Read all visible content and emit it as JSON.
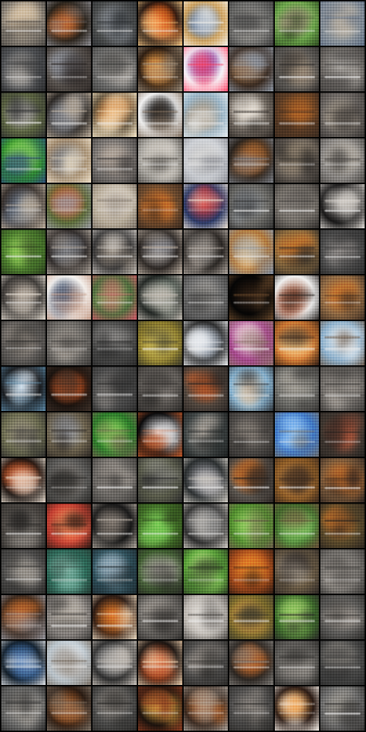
{
  "grid": {
    "rows": 16,
    "cols": 8,
    "tiles": [
      {
        "base": "#8a8277",
        "accent": "#d8c4a8",
        "detail": "#4a4744"
      },
      {
        "base": "#2a231b",
        "accent": "#c26b35",
        "detail": "#8d8d93"
      },
      {
        "base": "#4a4c4c",
        "accent": "#8a8f96",
        "detail": "#2b2e31"
      },
      {
        "base": "#1a0f0d",
        "accent": "#e4661f",
        "detail": "#ffd08a"
      },
      {
        "base": "#d1a35c",
        "accent": "#5e7aa1",
        "detail": "#f3f1eb"
      },
      {
        "base": "#6a6a68",
        "accent": "#9d9a96",
        "detail": "#3c3c3c"
      },
      {
        "base": "#6da74c",
        "accent": "#9a8b77",
        "detail": "#2d4a20"
      },
      {
        "base": "#8c949b",
        "accent": "#d2c2ab",
        "detail": "#5d6d83"
      },
      {
        "base": "#4d4f52",
        "accent": "#b8b3ad",
        "detail": "#2a2b2d"
      },
      {
        "base": "#5b5550",
        "accent": "#8a8d95",
        "detail": "#2b2523"
      },
      {
        "base": "#6a6a69",
        "accent": "#b6b1ab",
        "detail": "#3b3b3a"
      },
      {
        "base": "#2e1e12",
        "accent": "#f0a04a",
        "detail": "#9c8d7a"
      },
      {
        "base": "#f7f7fb",
        "accent": "#8d4aa6",
        "detail": "#ff4a6c"
      },
      {
        "base": "#3a2b21",
        "accent": "#a06c3b",
        "detail": "#8b95a3"
      },
      {
        "base": "#5f5c58",
        "accent": "#a08f7b",
        "detail": "#2f2d2c"
      },
      {
        "base": "#6b6763",
        "accent": "#aaa6a1",
        "detail": "#3d3b3a"
      },
      {
        "base": "#5b6441",
        "accent": "#a4a19c",
        "detail": "#2d2e2f"
      },
      {
        "base": "#2b2724",
        "accent": "#8b8d93",
        "detail": "#c2b3a0"
      },
      {
        "base": "#6a5b45",
        "accent": "#d57a29",
        "detail": "#fff0d1"
      },
      {
        "base": "#f2f2f2",
        "accent": "#0f0f10",
        "detail": "#7d6b5a"
      },
      {
        "base": "#9db7c8",
        "accent": "#a48f76",
        "detail": "#e8eef1"
      },
      {
        "base": "#6d655d",
        "accent": "#f0e9df",
        "detail": "#2f2a26"
      },
      {
        "base": "#5a3c25",
        "accent": "#c16c28",
        "detail": "#3a2a20"
      },
      {
        "base": "#6a6561",
        "accent": "#b3a897",
        "detail": "#3a3634"
      },
      {
        "base": "#2d8a2b",
        "accent": "#80d34e",
        "detail": "#2f4d7a"
      },
      {
        "base": "#a58f74",
        "accent": "#7b7f86",
        "detail": "#efe1c9"
      },
      {
        "base": "#777370",
        "accent": "#b6aa9f",
        "detail": "#3f3c3b"
      },
      {
        "base": "#a8a59f",
        "accent": "#efe9e0",
        "detail": "#4e4b47"
      },
      {
        "base": "#cfd2d7",
        "accent": "#f3f2ef",
        "detail": "#8b8d94"
      },
      {
        "base": "#2b241e",
        "accent": "#b06a32",
        "detail": "#7a7d84"
      },
      {
        "base": "#5d5650",
        "accent": "#9a8b77",
        "detail": "#2d2a27"
      },
      {
        "base": "#8c8986",
        "accent": "#b9b3aa",
        "detail": "#4b4845"
      },
      {
        "base": "#3a332f",
        "accent": "#5f6f86",
        "detail": "#c0b3a2"
      },
      {
        "base": "#5b6b3a",
        "accent": "#d05a2a",
        "detail": "#9a9aa2"
      },
      {
        "base": "#b8ad9b",
        "accent": "#dfd6ca",
        "detail": "#7b7167"
      },
      {
        "base": "#6d4b2f",
        "accent": "#e07a2b",
        "detail": "#3a2a1f"
      },
      {
        "base": "#2c3a66",
        "accent": "#d43b3b",
        "detail": "#f1e5d6"
      },
      {
        "base": "#6b6a66",
        "accent": "#9aa0a7",
        "detail": "#2f2f2f"
      },
      {
        "base": "#6f6a64",
        "accent": "#a19b94",
        "detail": "#2f2c2a"
      },
      {
        "base": "#171616",
        "accent": "#8f8c88",
        "detail": "#e7e2dc"
      },
      {
        "base": "#4a7a2d",
        "accent": "#95d15a",
        "detail": "#2a3c1d"
      },
      {
        "base": "#2c2725",
        "accent": "#7b7e85",
        "detail": "#b7aea4"
      },
      {
        "base": "#3b3a3a",
        "accent": "#8a7f73",
        "detail": "#d6d1cb"
      },
      {
        "base": "#2a2522",
        "accent": "#8e8f95",
        "detail": "#c5b8aa"
      },
      {
        "base": "#2a2623",
        "accent": "#7e7a76",
        "detail": "#b1a8a0"
      },
      {
        "base": "#b27a3c",
        "accent": "#f0d0a0",
        "detail": "#7c8ea5"
      },
      {
        "base": "#8b6a3e",
        "accent": "#d0772a",
        "detail": "#2b2a28"
      },
      {
        "base": "#4a4a4a",
        "accent": "#9a9592",
        "detail": "#2b2b2b"
      },
      {
        "base": "#3d3a37",
        "accent": "#a0958a",
        "detail": "#e7dfd4"
      },
      {
        "base": "#f6f3f0",
        "accent": "#4a5f7d",
        "detail": "#c49a85"
      },
      {
        "base": "#4c6d3d",
        "accent": "#9aa46b",
        "detail": "#d35a6a"
      },
      {
        "base": "#1e2320",
        "accent": "#7f8a80",
        "detail": "#c8c1b8"
      },
      {
        "base": "#6b6b6b",
        "accent": "#a8a5a0",
        "detail": "#3a3a3a"
      },
      {
        "base": "#050505",
        "accent": "#2a1c12",
        "detail": "#6b4a2c"
      },
      {
        "base": "#f0f0ef",
        "accent": "#a0563a",
        "detail": "#2a2523"
      },
      {
        "base": "#8f6a45",
        "accent": "#d27a2e",
        "detail": "#3b2c22"
      },
      {
        "base": "#5e5b58",
        "accent": "#9c938a",
        "detail": "#2f2e2c"
      },
      {
        "base": "#6d6a66",
        "accent": "#aaa39b",
        "detail": "#3b3937"
      },
      {
        "base": "#4a4a49",
        "accent": "#8c8a88",
        "detail": "#2a2a2a"
      },
      {
        "base": "#8a7a2c",
        "accent": "#d7c35c",
        "detail": "#3b3a2c"
      },
      {
        "base": "#2a2a2a",
        "accent": "#a6b0bd",
        "detail": "#f0f2f5"
      },
      {
        "base": "#a5488c",
        "accent": "#f2d7df",
        "detail": "#8a6e68"
      },
      {
        "base": "#d27b34",
        "accent": "#ffd089",
        "detail": "#2b1b14"
      },
      {
        "base": "#8fb1cc",
        "accent": "#f0f6fb",
        "detail": "#6b5a4b"
      },
      {
        "base": "#1a1c1f",
        "accent": "#d8e6f2",
        "detail": "#5b88a6"
      },
      {
        "base": "#1b130f",
        "accent": "#d3561f",
        "detail": "#3c2f27"
      },
      {
        "base": "#4b4b4b",
        "accent": "#8e8a86",
        "detail": "#2b2b2b"
      },
      {
        "base": "#5a5652",
        "accent": "#97908a",
        "detail": "#2c2a28"
      },
      {
        "base": "#51473f",
        "accent": "#c65d2b",
        "detail": "#2b2624"
      },
      {
        "base": "#8ab4d0",
        "accent": "#d9c7b1",
        "detail": "#2b2f34"
      },
      {
        "base": "#6b6b67",
        "accent": "#a39f97",
        "detail": "#353331"
      },
      {
        "base": "#6e6a66",
        "accent": "#aaa49d",
        "detail": "#3b3937"
      },
      {
        "base": "#6a6a4f",
        "accent": "#a8a08b",
        "detail": "#2b2b2b"
      },
      {
        "base": "#6e644f",
        "accent": "#a4a7ad",
        "detail": "#2b2622"
      },
      {
        "base": "#2c7a2a",
        "accent": "#85d05a",
        "detail": "#6a5b4a"
      },
      {
        "base": "#0a0a0b",
        "accent": "#f6f6f8",
        "detail": "#c45a2a"
      },
      {
        "base": "#3e4444",
        "accent": "#b6aea5",
        "detail": "#1c1f1f"
      },
      {
        "base": "#4d4a47",
        "accent": "#8f877f",
        "detail": "#2a2827"
      },
      {
        "base": "#3f79c6",
        "accent": "#9fd1ff",
        "detail": "#6b6c6d"
      },
      {
        "base": "#433a33",
        "accent": "#b2573b",
        "detail": "#262321"
      },
      {
        "base": "#1b1411",
        "accent": "#cf5b2b",
        "detail": "#eaded0"
      },
      {
        "base": "#5b5a58",
        "accent": "#9b948d",
        "detail": "#2b2a28"
      },
      {
        "base": "#6a6763",
        "accent": "#a39c95",
        "detail": "#3b3937"
      },
      {
        "base": "#595b4a",
        "accent": "#8c8c84",
        "detail": "#2b2b2b"
      },
      {
        "base": "#2b2f30",
        "accent": "#9a9aa0",
        "detail": "#d5d0c8"
      },
      {
        "base": "#5b5650",
        "accent": "#c36d2b",
        "detail": "#2b2522"
      },
      {
        "base": "#8c5b26",
        "accent": "#f0a450",
        "detail": "#3a2a1f"
      },
      {
        "base": "#7b5a3b",
        "accent": "#e07a2b",
        "detail": "#2b2320"
      },
      {
        "base": "#4a4642",
        "accent": "#8f8a84",
        "detail": "#2a2826"
      },
      {
        "base": "#c44033",
        "accent": "#ff8a5a",
        "detail": "#2a1a14"
      },
      {
        "base": "#171717",
        "accent": "#6a625b",
        "detail": "#b2a99f"
      },
      {
        "base": "#3f6b26",
        "accent": "#7fd15a",
        "detail": "#2a3b1a"
      },
      {
        "base": "#2a2a2a",
        "accent": "#8a8a8a",
        "detail": "#d8d3cc"
      },
      {
        "base": "#4f8a2d",
        "accent": "#a2e06b",
        "detail": "#6b5a4a"
      },
      {
        "base": "#3d6a2a",
        "accent": "#8bd36a",
        "detail": "#6b4f3a"
      },
      {
        "base": "#5b4a2b",
        "accent": "#d77a2b",
        "detail": "#2b2520"
      },
      {
        "base": "#4b4a49",
        "accent": "#9b968f",
        "detail": "#2b2a28"
      },
      {
        "base": "#2e6b5a",
        "accent": "#8fc6b6",
        "detail": "#243a33"
      },
      {
        "base": "#2e4f5a",
        "accent": "#9bb2c0",
        "detail": "#1f2b30"
      },
      {
        "base": "#3b5a2c",
        "accent": "#a8a39c",
        "detail": "#2b2a28"
      },
      {
        "base": "#5aa33a",
        "accent": "#b0e07a",
        "detail": "#2b3a22"
      },
      {
        "base": "#a24a1c",
        "accent": "#f08a2b",
        "detail": "#2b1a12"
      },
      {
        "base": "#6a5b45",
        "accent": "#b9ad9c",
        "detail": "#2b2624"
      },
      {
        "base": "#6f6c68",
        "accent": "#a59f98",
        "detail": "#3b3937"
      },
      {
        "base": "#3a2a20",
        "accent": "#c56a2b",
        "detail": "#9a9aa2"
      },
      {
        "base": "#8c8783",
        "accent": "#b9b2a9",
        "detail": "#3b3937"
      },
      {
        "base": "#2b1b14",
        "accent": "#e07a2b",
        "detail": "#f2e0c6"
      },
      {
        "base": "#6b6864",
        "accent": "#a29c95",
        "detail": "#2f2d2b"
      },
      {
        "base": "#bcb7b1",
        "accent": "#f0ece7",
        "detail": "#4b4845"
      },
      {
        "base": "#7a6a2c",
        "accent": "#e0a44a",
        "detail": "#3b3a2c"
      },
      {
        "base": "#3b6a2a",
        "accent": "#9fd16a",
        "detail": "#2b2a28"
      },
      {
        "base": "#5b5a58",
        "accent": "#9b948d",
        "detail": "#2b2a28"
      },
      {
        "base": "#0f1a24",
        "accent": "#4a78b2",
        "detail": "#e6e9ee"
      },
      {
        "base": "#bfcbd4",
        "accent": "#f0f2f5",
        "detail": "#7a6f63"
      },
      {
        "base": "#2a2a2a",
        "accent": "#8a8a8a",
        "detail": "#cfc8c0"
      },
      {
        "base": "#1b1411",
        "accent": "#d65b2a",
        "detail": "#f0d2b0"
      },
      {
        "base": "#4b4a49",
        "accent": "#8d8781",
        "detail": "#2b2a28"
      },
      {
        "base": "#2b2622",
        "accent": "#c56a2b",
        "detail": "#7d7a76"
      },
      {
        "base": "#5b5956",
        "accent": "#9a958f",
        "detail": "#2b2a28"
      },
      {
        "base": "#4a4a49",
        "accent": "#8b8781",
        "detail": "#2a2a2a"
      },
      {
        "base": "#6a6a69",
        "accent": "#a8a39c",
        "detail": "#2b2b2b"
      },
      {
        "base": "#2a1b12",
        "accent": "#c46a2b",
        "detail": "#7a6f63"
      },
      {
        "base": "#4a4a49",
        "accent": "#8d8781",
        "detail": "#2b2a28"
      },
      {
        "base": "#1b120d",
        "accent": "#f0b44a",
        "detail": "#8a3b20"
      },
      {
        "base": "#3b2a20",
        "accent": "#c56a2b",
        "detail": "#a8a39c"
      },
      {
        "base": "#4b4a49",
        "accent": "#8d8781",
        "detail": "#2b2a28"
      },
      {
        "base": "#2b1b14",
        "accent": "#f0a04a",
        "detail": "#f7f2eb"
      },
      {
        "base": "#6b6b6b",
        "accent": "#a39f97",
        "detail": "#353331"
      }
    ]
  }
}
